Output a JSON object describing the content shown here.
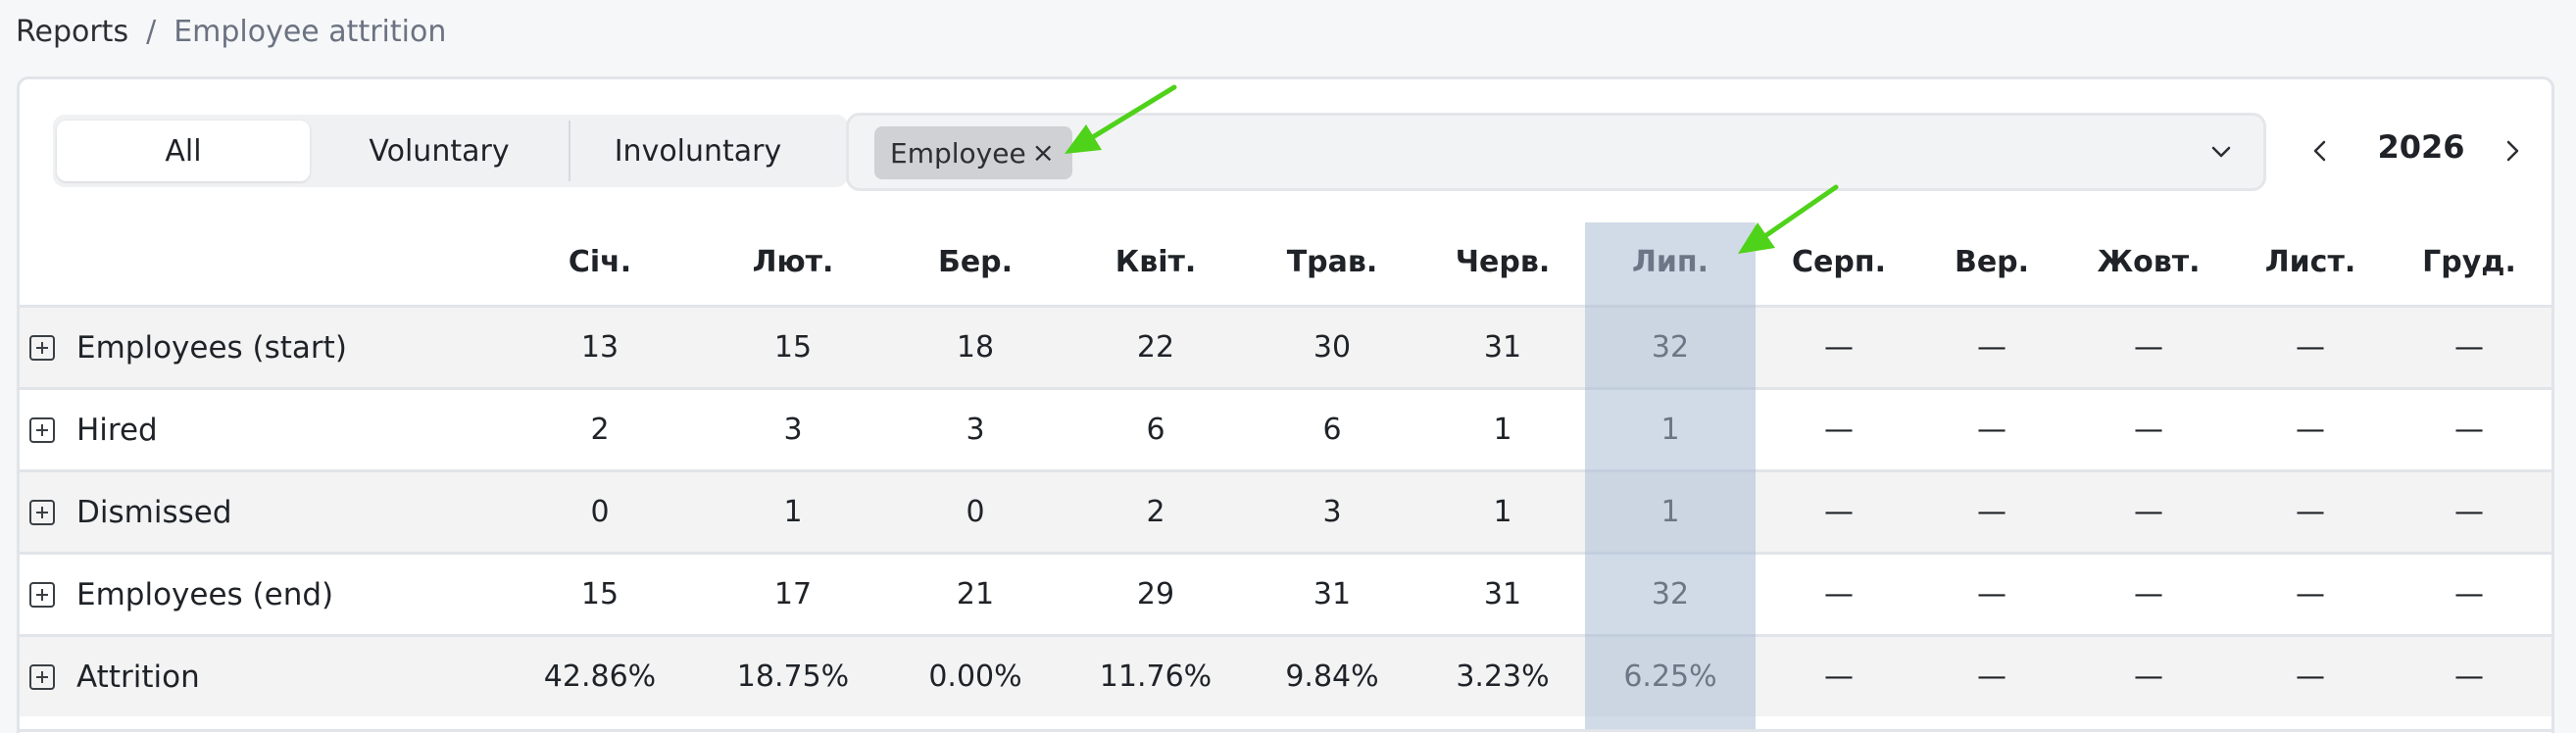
{
  "breadcrumb": {
    "root": "Reports",
    "separator": "/",
    "current": "Employee attrition"
  },
  "tabs": [
    {
      "label": "All",
      "active": true
    },
    {
      "label": "Voluntary",
      "active": false
    },
    {
      "label": "Involuntary",
      "active": false
    }
  ],
  "filter": {
    "chip_label": "Employee",
    "remove_icon": "×"
  },
  "year_nav": {
    "year": "2026"
  },
  "highlight_color": "#acbcd4",
  "months": [
    "Січ.",
    "Лют.",
    "Бер.",
    "Квіт.",
    "Трав.",
    "Черв.",
    "Лип.",
    "Серп.",
    "Вер.",
    "Жовт.",
    "Лист.",
    "Груд."
  ],
  "rows": [
    {
      "label": "Employees (start)",
      "values": [
        "13",
        "15",
        "18",
        "22",
        "30",
        "31",
        "32",
        "—",
        "—",
        "—",
        "—",
        "—"
      ]
    },
    {
      "label": "Hired",
      "values": [
        "2",
        "3",
        "3",
        "6",
        "6",
        "1",
        "1",
        "—",
        "—",
        "—",
        "—",
        "—"
      ]
    },
    {
      "label": "Dismissed",
      "values": [
        "0",
        "1",
        "0",
        "2",
        "3",
        "1",
        "1",
        "—",
        "—",
        "—",
        "—",
        "—"
      ]
    },
    {
      "label": "Employees (end)",
      "values": [
        "15",
        "17",
        "21",
        "29",
        "31",
        "31",
        "32",
        "—",
        "—",
        "—",
        "—",
        "—"
      ]
    },
    {
      "label": "Attrition",
      "values": [
        "42.86%",
        "18.75%",
        "0.00%",
        "11.76%",
        "9.84%",
        "3.23%",
        "6.25%",
        "—",
        "—",
        "—",
        "—",
        "—"
      ]
    }
  ]
}
